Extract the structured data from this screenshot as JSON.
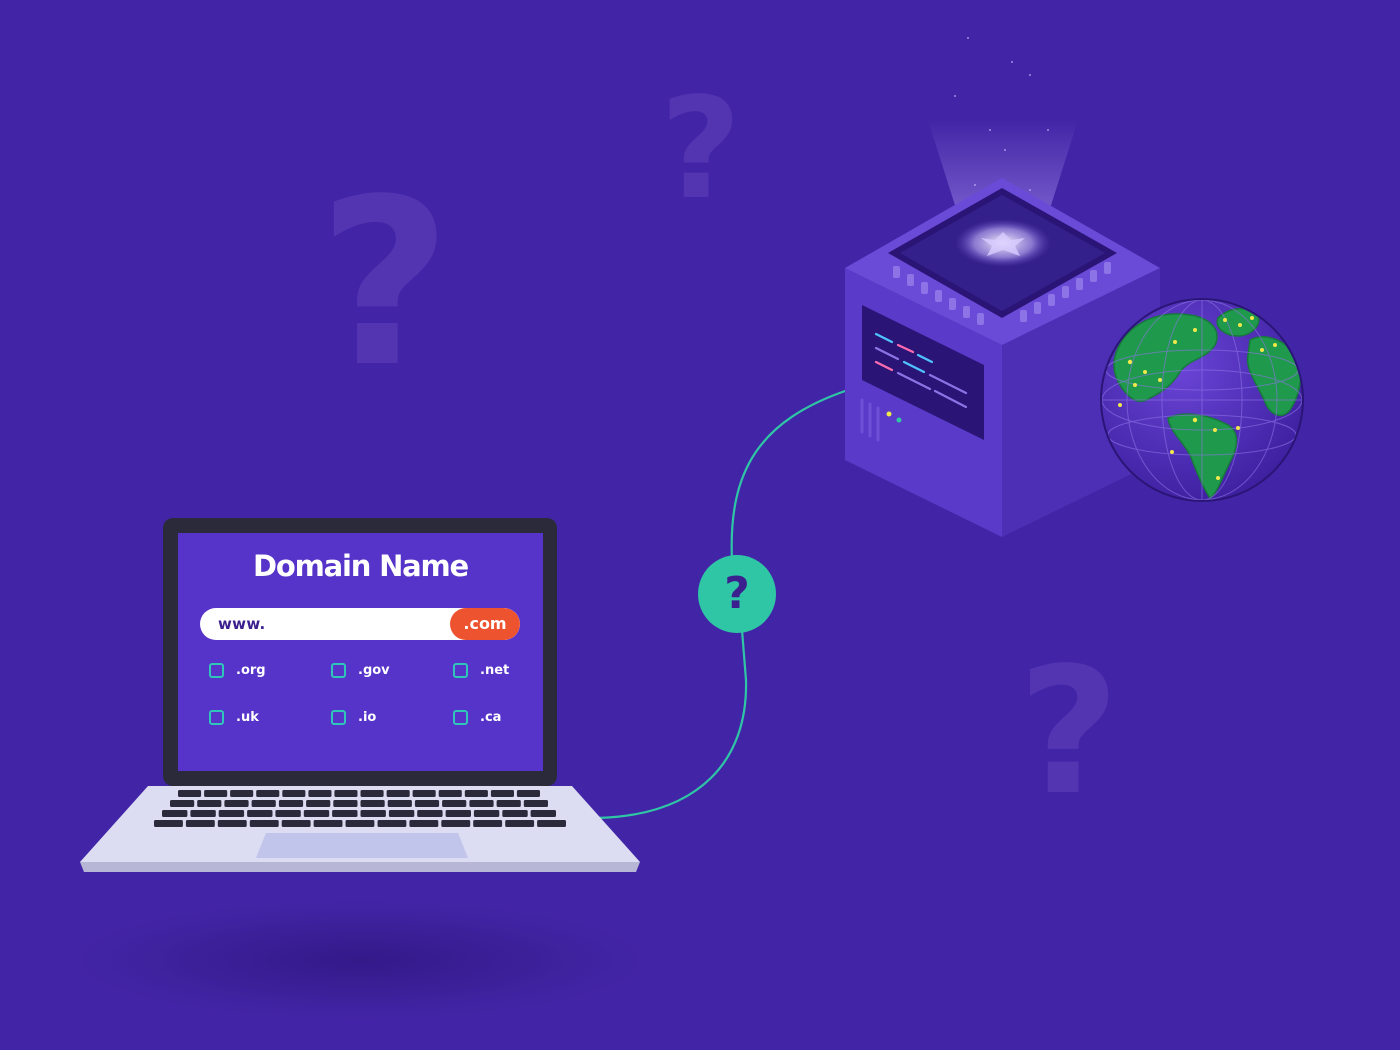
{
  "laptop": {
    "screen": {
      "title": "Domain Name",
      "url_prefix": "www.",
      "selected_tld": ".com",
      "extensions": [
        ".org",
        ".gov",
        ".net",
        ".uk",
        ".io",
        ".ca"
      ]
    }
  },
  "connection": {
    "badge_symbol": "?"
  },
  "background": {
    "symbols": [
      "?",
      "?",
      "?"
    ]
  },
  "colors": {
    "background": "#4225a6",
    "laptop_screen": "#5633c9",
    "tld_pill": "#ee5330",
    "checkbox": "#2fc6b9",
    "connector": "#2fc6a5",
    "server": "#5a3ac8",
    "globe_ocean": "#5530c0",
    "globe_land": "#1f9a4c",
    "city_lights": "#f3e84a"
  },
  "icons": [
    "server-icon",
    "globe-icon",
    "laptop-icon",
    "question-mark-icon"
  ]
}
